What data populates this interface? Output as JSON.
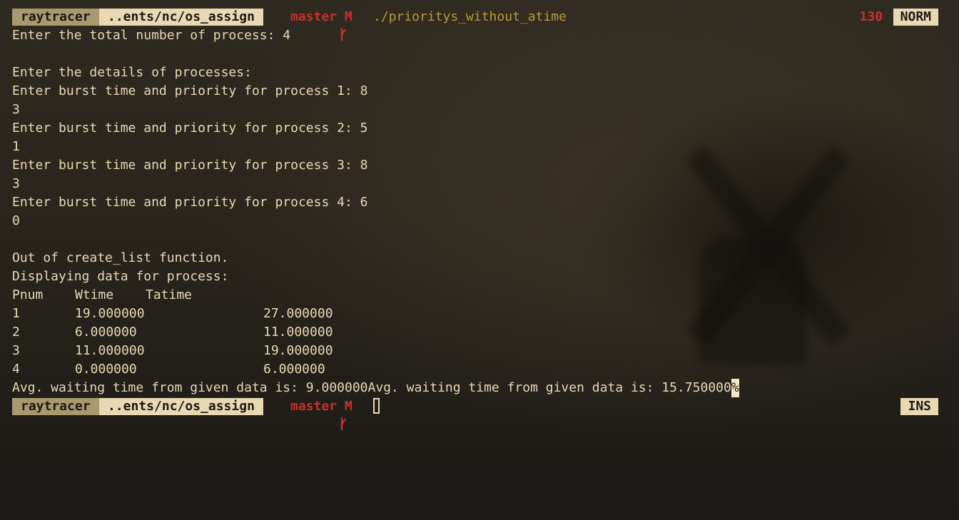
{
  "prompt": {
    "host": "raytracer",
    "dir": "..ents/nc/os_assign",
    "git_branch": "master M",
    "command": "./prioritys_without_atime",
    "exit_code": "130",
    "mode_top": "NORM",
    "mode_bottom": "INS"
  },
  "output": {
    "line_total": "Enter the total number of process: 4",
    "line_details": "Enter the details of processes:",
    "inputs": [
      {
        "prompt": "Enter burst time and priority for process 1: 8",
        "value": "3"
      },
      {
        "prompt": "Enter burst time and priority for process 2: 5",
        "value": "1"
      },
      {
        "prompt": "Enter burst time and priority for process 3: 8",
        "value": "3"
      },
      {
        "prompt": "Enter burst time and priority for process 4: 6",
        "value": "0"
      }
    ],
    "line_out": "Out of create_list function.",
    "line_display": "Displaying data for process:",
    "table": {
      "headers": [
        "Pnum",
        "Wtime",
        "Tatime"
      ],
      "rows": [
        [
          "1",
          "19.000000",
          "27.000000"
        ],
        [
          "2",
          "6.000000",
          "11.000000"
        ],
        [
          "3",
          "11.000000",
          "19.000000"
        ],
        [
          "4",
          "0.000000",
          "6.000000"
        ]
      ]
    },
    "avg_line": "Avg. waiting time from given data is: 9.000000Avg. waiting time from given data is: 15.750000",
    "end_marker": "%"
  }
}
